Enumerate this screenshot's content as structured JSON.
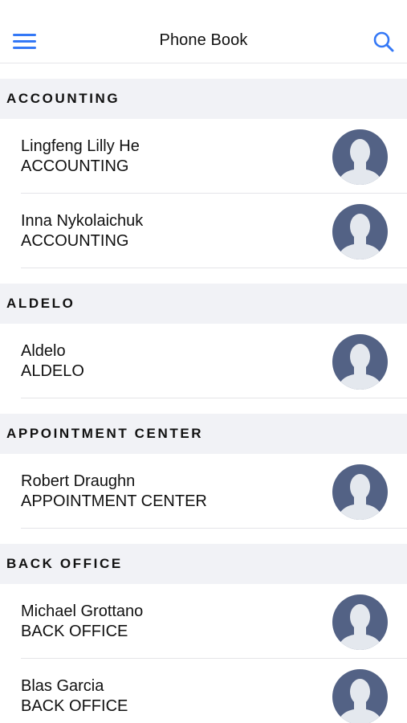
{
  "header": {
    "title": "Phone Book",
    "menu_icon": "hamburger-menu-icon",
    "search_icon": "search-icon"
  },
  "colors": {
    "accent": "#3478f6",
    "avatar_bg": "#536285",
    "avatar_fg": "#e4e8ee",
    "section_bg": "#f1f2f6"
  },
  "sections": [
    {
      "title": "ACCOUNTING",
      "contacts": [
        {
          "name": "Lingfeng Lilly He",
          "department": "ACCOUNTING"
        },
        {
          "name": "Inna Nykolaichuk",
          "department": "ACCOUNTING"
        }
      ]
    },
    {
      "title": "ALDELO",
      "contacts": [
        {
          "name": "Aldelo",
          "department": "ALDELO"
        }
      ]
    },
    {
      "title": "APPOINTMENT CENTER",
      "contacts": [
        {
          "name": "Robert Draughn",
          "department": "APPOINTMENT CENTER"
        }
      ]
    },
    {
      "title": "BACK OFFICE",
      "contacts": [
        {
          "name": "Michael Grottano",
          "department": "BACK OFFICE"
        },
        {
          "name": "Blas Garcia",
          "department": "BACK OFFICE"
        }
      ]
    }
  ]
}
